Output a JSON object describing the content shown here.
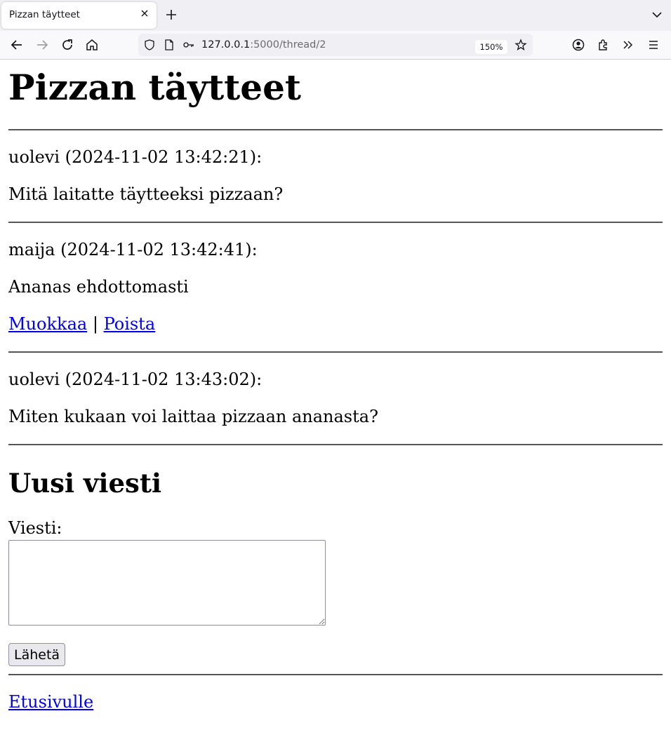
{
  "browser": {
    "tab_title": "Pizzan täytteet",
    "url_host": "127.0.0.1",
    "url_rest": ":5000/thread/2",
    "zoom": "150%"
  },
  "page": {
    "heading": "Pizzan täytteet",
    "messages": [
      {
        "header": "uolevi (2024-11-02 13:42:21):",
        "body": "Mitä laitatte täytteeksi pizzaan?"
      },
      {
        "header": "maija (2024-11-02 13:42:41):",
        "body": "Ananas ehdottomasti",
        "edit_label": "Muokkaa",
        "separator": "|",
        "delete_label": "Poista"
      },
      {
        "header": "uolevi (2024-11-02 13:43:02):",
        "body": "Miten kukaan voi laittaa pizzaan ananasta?"
      }
    ],
    "new_message": {
      "heading": "Uusi viesti",
      "label": "Viesti:",
      "value": "",
      "submit_label": "Lähetä"
    },
    "home_link": "Etusivulle"
  }
}
